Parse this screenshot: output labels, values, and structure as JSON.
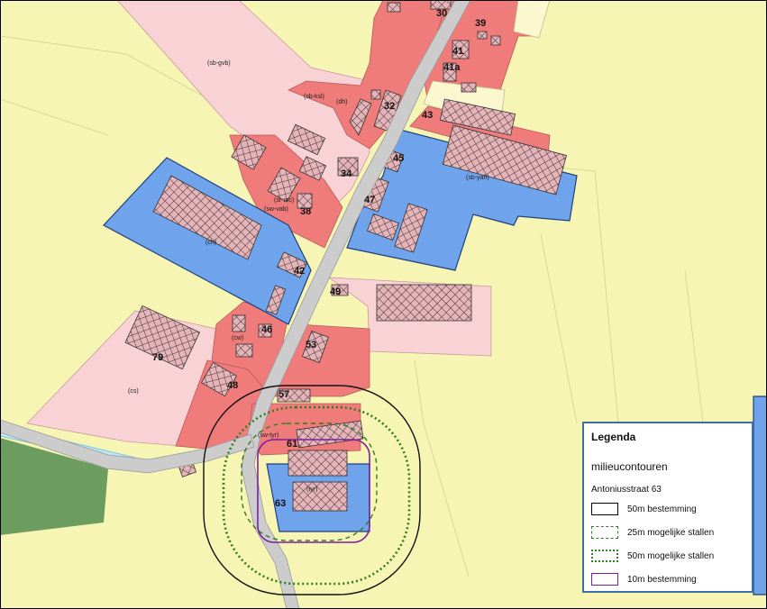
{
  "house_numbers": [
    "30",
    "39",
    "41",
    "41a",
    "32",
    "43",
    "34",
    "45",
    "38",
    "47",
    "42",
    "49",
    "46",
    "53",
    "79",
    "48",
    "57",
    "61",
    "63"
  ],
  "zone_codes": [
    "(sb-gvb)",
    "(sb-ksl)",
    "(dh)",
    "(sr-mc)",
    "(sw-vab)",
    "(sb-yah)",
    "(ch)",
    "(cw)",
    "(cs)",
    "(sw-tyr)",
    "(tyr)"
  ],
  "legend": {
    "title": "Legenda",
    "subtitle": "milieucontouren",
    "address": "Antoniusstraat 63",
    "items": [
      {
        "label": "50m bestemming",
        "color": "#000000",
        "style": "solid"
      },
      {
        "label": "25m mogelijke stallen",
        "color": "#2e7d1f",
        "style": "dashed"
      },
      {
        "label": "50m mogelijke stallen",
        "color": "#2e7d1f",
        "style": "dotted"
      },
      {
        "label": "10m bestemming",
        "color": "#7b1fa2",
        "style": "solid"
      }
    ]
  },
  "colors": {
    "agricultural": "#f7f5b4",
    "residential": "#f07b7b",
    "business": "#6fa4ec",
    "garden": "#f9d2d6",
    "forest": "#6d9d5e",
    "road": "#cccccc",
    "water": "#bfe6f2"
  }
}
